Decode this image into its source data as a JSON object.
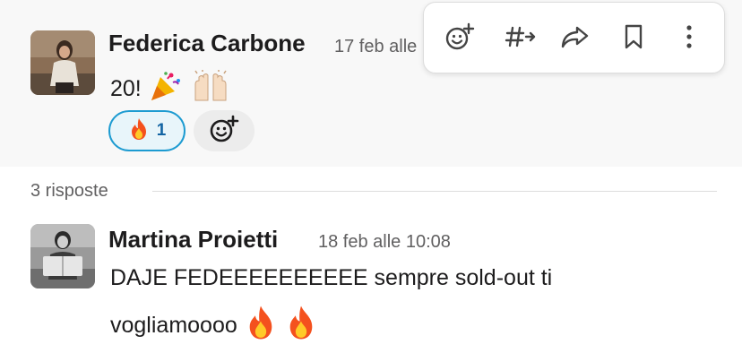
{
  "parent": {
    "author": "Federica Carbone",
    "timestamp": "17 feb alle",
    "text": "20!",
    "emojis": [
      "party-popper",
      "raising-hands"
    ],
    "reactions": [
      {
        "emoji": "fire",
        "count": "1",
        "active": true
      }
    ]
  },
  "toolbar": {
    "actions": [
      "add-reaction",
      "reply-in-thread",
      "share-message",
      "save-for-later",
      "more-actions"
    ]
  },
  "replies": {
    "label": "3 risposte"
  },
  "reply": {
    "author": "Martina Proietti",
    "timestamp": "18 feb alle 10:08",
    "text_line1": "DAJE FEDEEEEEEEEEE sempre sold-out ti",
    "text_line2": "vogliamoooo",
    "emojis": [
      "fire",
      "fire"
    ]
  },
  "colors": {
    "reaction_border": "#1d9bd1",
    "reaction_bg": "#e8f5fa",
    "reaction_count": "#1264a3",
    "parent_bg": "#f8f8f8"
  }
}
